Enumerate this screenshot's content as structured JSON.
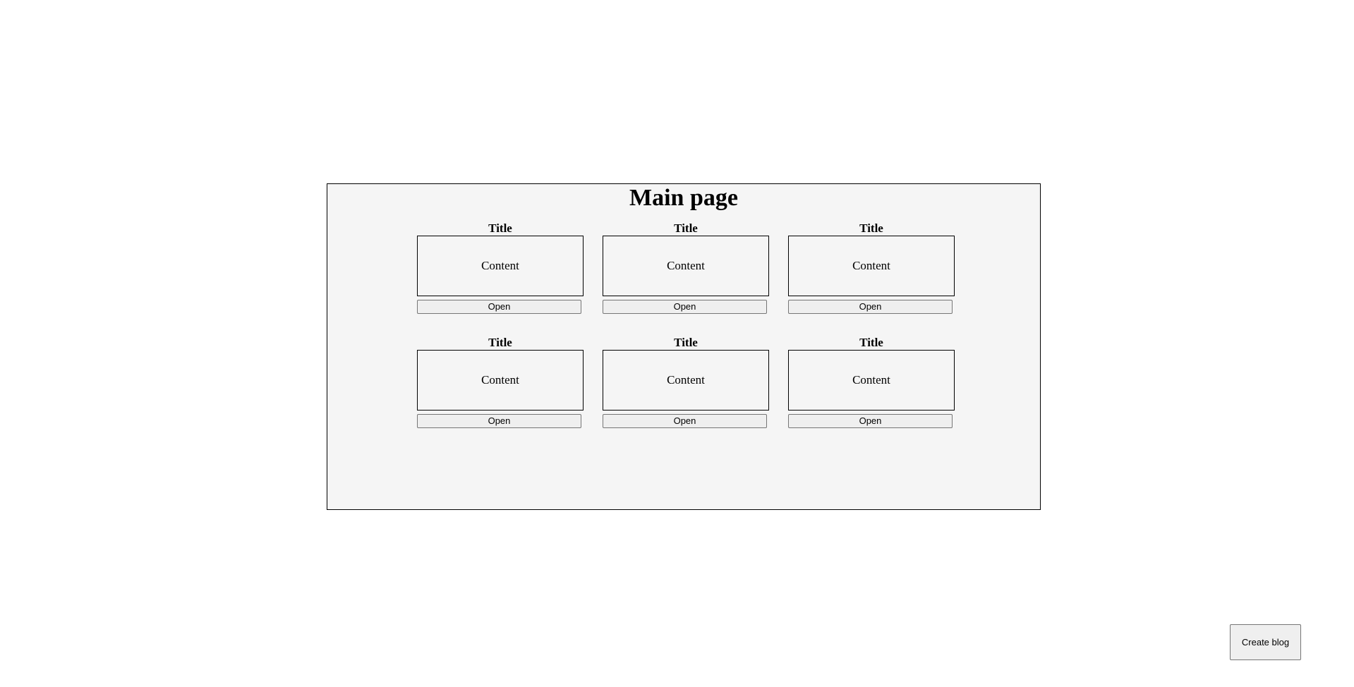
{
  "main": {
    "title": "Main page",
    "cards": [
      {
        "title": "Title",
        "content": "Content",
        "button_label": "Open"
      },
      {
        "title": "Title",
        "content": "Content",
        "button_label": "Open"
      },
      {
        "title": "Title",
        "content": "Content",
        "button_label": "Open"
      },
      {
        "title": "Title",
        "content": "Content",
        "button_label": "Open"
      },
      {
        "title": "Title",
        "content": "Content",
        "button_label": "Open"
      },
      {
        "title": "Title",
        "content": "Content",
        "button_label": "Open"
      }
    ]
  },
  "actions": {
    "create_label": "Create blog"
  }
}
